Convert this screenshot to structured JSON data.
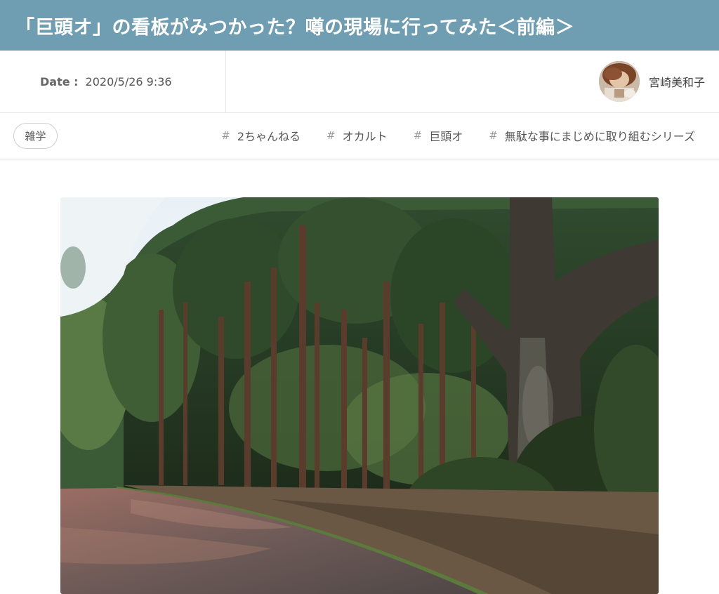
{
  "article": {
    "title": "「巨頭オ」の看板がみつかった？噂の現場に行ってみた＜前編＞"
  },
  "meta": {
    "date_label": "Date :",
    "date_value": "2020/5/26 9:36",
    "author_name": "宮崎美和子"
  },
  "category": {
    "label": "雑学"
  },
  "tags": [
    {
      "hash": "#",
      "label": "2ちゃんねる"
    },
    {
      "hash": "#",
      "label": "オカルト"
    },
    {
      "hash": "#",
      "label": "巨頭オ"
    },
    {
      "hash": "#",
      "label": "無駄な事にまじめに取り組むシリーズ"
    }
  ],
  "colors": {
    "title_bar": "#6f9db2",
    "title_text": "#ffffff"
  },
  "icons": {
    "avatar": "author-avatar-photo",
    "photo": "forest-road-photo"
  }
}
